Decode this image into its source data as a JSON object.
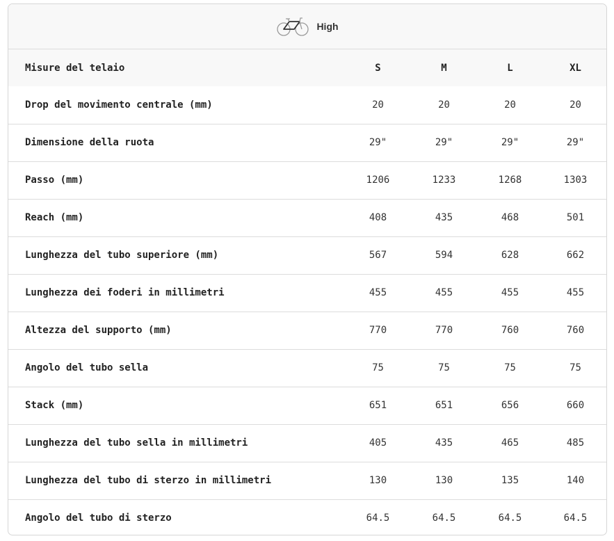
{
  "geometry": {
    "label": "High",
    "icon": "bike-icon"
  },
  "table": {
    "header": {
      "name": "Misure del telaio",
      "sizes": [
        "S",
        "M",
        "L",
        "XL"
      ]
    },
    "rows": [
      {
        "name": "Drop del movimento centrale (mm)",
        "values": [
          "20",
          "20",
          "20",
          "20"
        ]
      },
      {
        "name": "Dimensione della ruota",
        "values": [
          "29\"",
          "29\"",
          "29\"",
          "29\""
        ]
      },
      {
        "name": "Passo (mm)",
        "values": [
          "1206",
          "1233",
          "1268",
          "1303"
        ]
      },
      {
        "name": "Reach (mm)",
        "values": [
          "408",
          "435",
          "468",
          "501"
        ]
      },
      {
        "name": "Lunghezza del tubo superiore (mm)",
        "values": [
          "567",
          "594",
          "628",
          "662"
        ]
      },
      {
        "name": "Lunghezza dei foderi in millimetri",
        "values": [
          "455",
          "455",
          "455",
          "455"
        ]
      },
      {
        "name": "Altezza del supporto (mm)",
        "values": [
          "770",
          "770",
          "760",
          "760"
        ]
      },
      {
        "name": "Angolo del tubo sella",
        "values": [
          "75",
          "75",
          "75",
          "75"
        ]
      },
      {
        "name": "Stack (mm)",
        "values": [
          "651",
          "651",
          "656",
          "660"
        ]
      },
      {
        "name": "Lunghezza del tubo sella in millimetri",
        "values": [
          "405",
          "435",
          "465",
          "485"
        ]
      },
      {
        "name": "Lunghezza del tubo di sterzo in millimetri",
        "values": [
          "130",
          "130",
          "135",
          "140"
        ]
      },
      {
        "name": "Angolo del tubo di sterzo",
        "values": [
          "64.5",
          "64.5",
          "64.5",
          "64.5"
        ]
      }
    ]
  }
}
